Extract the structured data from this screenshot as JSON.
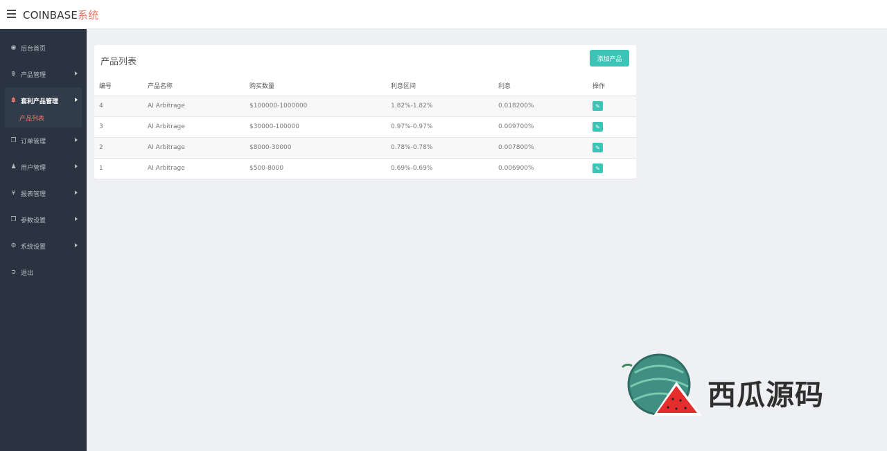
{
  "header": {
    "brand_main": "COINBASE",
    "brand_accent": "系统"
  },
  "sidebar": {
    "items": [
      {
        "label": "后台首页",
        "icon": "dashboard-icon"
      },
      {
        "label": "产品管理",
        "icon": "bitcoin-icon"
      },
      {
        "label": "套利产品管理",
        "icon": "bitcoin-icon"
      },
      {
        "label": "订单管理",
        "icon": "copy-icon"
      },
      {
        "label": "用户管理",
        "icon": "user-icon"
      },
      {
        "label": "报表管理",
        "icon": "yen-icon"
      },
      {
        "label": "参数设置",
        "icon": "copy-icon"
      },
      {
        "label": "系统设置",
        "icon": "gears-icon"
      },
      {
        "label": "退出",
        "icon": "sign-out-icon"
      }
    ],
    "active_sub": "产品列表"
  },
  "panel": {
    "title": "产品列表",
    "add_button": "添加产品"
  },
  "table": {
    "headers": [
      "编号",
      "产品名称",
      "购买数量",
      "利息区间",
      "利息",
      "操作"
    ],
    "rows": [
      {
        "id": "4",
        "name": "AI Arbitrage",
        "amount": "$100000-1000000",
        "range": "1.82%-1.82%",
        "rate": "0.018200%"
      },
      {
        "id": "3",
        "name": "AI Arbitrage",
        "amount": "$30000-100000",
        "range": "0.97%-0.97%",
        "rate": "0.009700%"
      },
      {
        "id": "2",
        "name": "AI Arbitrage",
        "amount": "$8000-30000",
        "range": "0.78%-0.78%",
        "rate": "0.007800%"
      },
      {
        "id": "1",
        "name": "AI Arbitrage",
        "amount": "$500-8000",
        "range": "0.69%-0.69%",
        "rate": "0.006900%"
      }
    ]
  },
  "watermark": {
    "text": "西瓜源码"
  },
  "colors": {
    "accent": "#3cc4b6",
    "sidebar_bg": "#2a3441",
    "active_red": "#f0786a"
  }
}
